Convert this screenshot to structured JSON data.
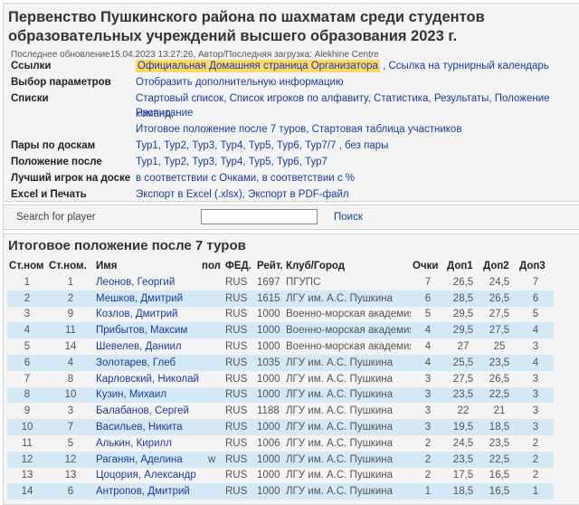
{
  "header": {
    "title": "Первенство Пушкинского района по шахматам среди студентов образовательных учреждений высшего образования 2023 г.",
    "updated": "Последнее обновление15.04.2023 13:27:26, Автор/Последняя загрузка: Alekhine Centre"
  },
  "info": [
    {
      "label": "Ссылки",
      "parts": [
        {
          "text": "Официальная Домашняя страница Организатора",
          "hl": true
        },
        {
          "text": " , Ссылка на турнирный календарь",
          "hl": false
        }
      ]
    },
    {
      "label": "Выбор параметров",
      "parts": [
        {
          "text": "Отобразить дополнительную информацию",
          "hl": false
        }
      ]
    },
    {
      "label": "Списки",
      "parts": [
        {
          "text": "Стартовый список, Список игроков по алфавиту, Статистика, Результаты, Положение команд,",
          "hl": false
        }
      ]
    },
    {
      "label": "",
      "parts": [
        {
          "text": "Расписание",
          "hl": false
        }
      ]
    },
    {
      "label": "",
      "parts": [
        {
          "text": "Итоговое положение после 7 туров, Стартовая таблица участников",
          "hl": false
        }
      ]
    },
    {
      "label": "Пары по доскам",
      "parts": [
        {
          "text": "Тур1, Тур2, Тур3, Тур4, Тур5, Тур6, Тур7/7 , без пары",
          "hl": false
        }
      ]
    },
    {
      "label": "Положение после",
      "parts": [
        {
          "text": "Тур1, Тур2, Тур3, Тур4, Тур5, Тур6, Тур7",
          "hl": false
        }
      ]
    },
    {
      "label": "Лучший игрок на доске",
      "parts": [
        {
          "text": "в соответствии с Очками, в соответствии с %",
          "hl": false
        }
      ]
    },
    {
      "label": "Excel и Печать",
      "parts": [
        {
          "text": "Экспорт в Excel (.xlsx), Экспорт в PDF-файл",
          "hl": false
        }
      ]
    }
  ],
  "search": {
    "label": "Search for player",
    "value": "",
    "button": "Поиск"
  },
  "results": {
    "title": "Итоговое положение после 7 туров",
    "columns": [
      "Ст.ном",
      "Ст.ном.",
      "Имя",
      "пол",
      "ФЕД.",
      "Рейт.",
      "Клуб/Город",
      "Очки",
      "Доп1",
      "Доп2",
      "Доп3"
    ],
    "rows": [
      [
        "1",
        "1",
        "Леонов, Георгий",
        "",
        "RUS",
        "1697",
        "ПГУПС",
        "7",
        "26,5",
        "24,5",
        "7"
      ],
      [
        "2",
        "2",
        "Мешков, Дмитрий",
        "",
        "RUS",
        "1615",
        "ЛГУ им. А.С. Пушкина",
        "6",
        "28,5",
        "26,5",
        "6"
      ],
      [
        "3",
        "9",
        "Козлов, Дмитрий",
        "",
        "RUS",
        "1000",
        "Военно-морская академия",
        "5",
        "29,5",
        "27,5",
        "5"
      ],
      [
        "4",
        "11",
        "Прибытов, Максим",
        "",
        "RUS",
        "1000",
        "Военно-морская академия",
        "4",
        "29,5",
        "27,5",
        "4"
      ],
      [
        "5",
        "14",
        "Шевелев, Даниил",
        "",
        "RUS",
        "1000",
        "Военно-морская академия",
        "4",
        "27",
        "25",
        "3"
      ],
      [
        "6",
        "4",
        "Золотарев, Глеб",
        "",
        "RUS",
        "1035",
        "ЛГУ им. А.С. Пушкина",
        "4",
        "25,5",
        "23,5",
        "4"
      ],
      [
        "7",
        "8",
        "Карловский, Николай",
        "",
        "RUS",
        "1000",
        "ЛГУ им. А.С. Пушкина",
        "3",
        "27,5",
        "26,5",
        "3"
      ],
      [
        "8",
        "10",
        "Кузин, Михаил",
        "",
        "RUS",
        "1000",
        "ЛГУ им. А.С. Пушкина",
        "3",
        "23,5",
        "22,5",
        "3"
      ],
      [
        "9",
        "3",
        "Балабанов, Сергей",
        "",
        "RUS",
        "1188",
        "ЛГУ им. А.С. Пушкина",
        "3",
        "22",
        "21",
        "3"
      ],
      [
        "10",
        "7",
        "Васильев, Никита",
        "",
        "RUS",
        "1000",
        "ЛГУ им. А.С. Пушкина",
        "3",
        "19,5",
        "18,5",
        "3"
      ],
      [
        "11",
        "5",
        "Алькин, Кирилл",
        "",
        "RUS",
        "1006",
        "ЛГУ им. А.С. Пушкина",
        "2",
        "24,5",
        "23,5",
        "2"
      ],
      [
        "12",
        "12",
        "Раганян, Аделина",
        "w",
        "RUS",
        "1000",
        "ЛГУ им. А.С. Пушкина",
        "2",
        "23,5",
        "22,5",
        "2"
      ],
      [
        "13",
        "13",
        "Цоцория, Александр",
        "",
        "RUS",
        "1000",
        "ЛГУ им. А.С. Пушкина",
        "2",
        "17,5",
        "16,5",
        "2"
      ],
      [
        "14",
        "6",
        "Антропов, Дмитрий",
        "",
        "RUS",
        "1000",
        "ЛГУ им. А.С. Пушкина",
        "1",
        "18,5",
        "16,5",
        "1"
      ]
    ]
  }
}
